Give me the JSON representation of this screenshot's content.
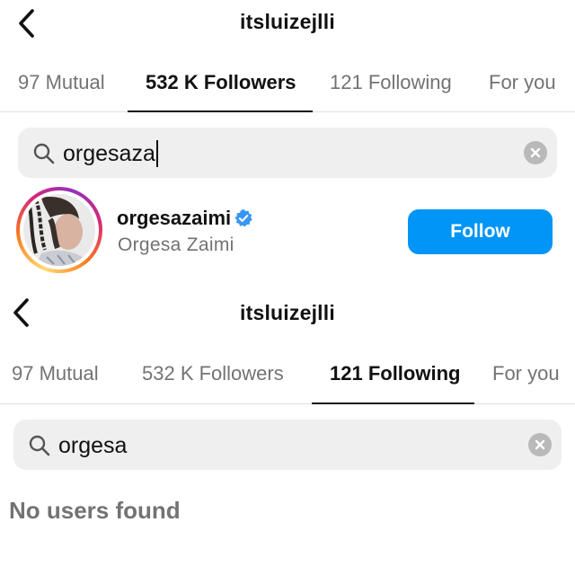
{
  "top": {
    "username": "itsluizejlli",
    "back_icon": "chevron-left-icon",
    "tabs": [
      {
        "label": "97 Mutual",
        "active": false
      },
      {
        "label": "532 K Followers",
        "active": true
      },
      {
        "label": "121 Following",
        "active": false
      },
      {
        "label": "For you",
        "active": false
      }
    ],
    "search": {
      "value": "orgesaza",
      "search_icon": "search-icon",
      "clear_icon": "clear-icon"
    },
    "result": {
      "username": "orgesazaimi",
      "verified": true,
      "verified_icon": "verified-badge-icon",
      "full_name": "Orgesa Zaimi",
      "follow_label": "Follow"
    }
  },
  "bottom": {
    "username": "itsluizejlli",
    "back_icon": "chevron-left-icon",
    "tabs": [
      {
        "label": "97 Mutual",
        "active": false
      },
      {
        "label": "532 K Followers",
        "active": false
      },
      {
        "label": "121 Following",
        "active": true
      },
      {
        "label": "For you",
        "active": false
      }
    ],
    "search": {
      "value": "orgesa",
      "search_icon": "search-icon",
      "clear_icon": "clear-icon"
    },
    "empty_message": "No users found"
  },
  "colors": {
    "accent": "#0095f6",
    "text_primary": "#111111",
    "text_secondary": "#737373",
    "search_bg": "#efefef"
  }
}
